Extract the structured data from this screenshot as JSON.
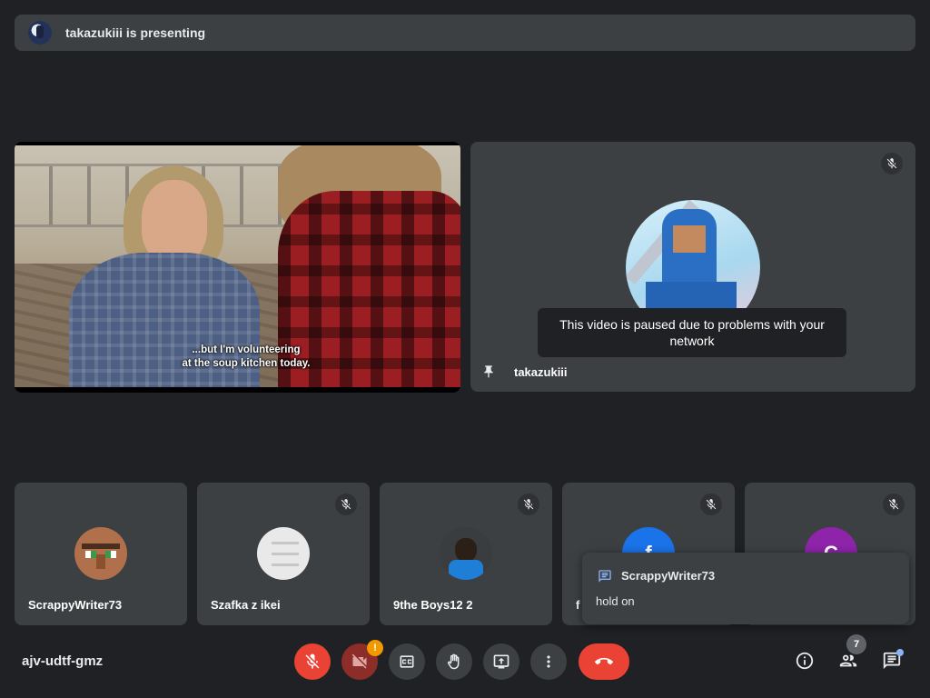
{
  "banner": {
    "presenter_text": "takazukiii is presenting"
  },
  "presentation": {
    "caption": "...but I'm volunteering\nat the soup kitchen today."
  },
  "main_tile": {
    "participant": "takazukiii",
    "paused_message": "This video is paused due to problems with your network"
  },
  "participants": [
    {
      "name": "ScrappyWriter73",
      "avatar": "minecraft-villager",
      "muted": false
    },
    {
      "name": "Szafka z ikei",
      "avatar": "white-dresser",
      "muted": true
    },
    {
      "name": "9the Boys12 2",
      "avatar": "boy-blue-shirt",
      "muted": true
    },
    {
      "name": "f",
      "avatar_letter": "f",
      "avatar_color": "#1a73e8",
      "muted": true
    },
    {
      "name": "",
      "avatar_letter": "C",
      "avatar_color": "#8e24aa",
      "muted": true
    }
  ],
  "toast": {
    "sender": "ScrappyWriter73",
    "message": "hold on"
  },
  "bottom_bar": {
    "meeting_code": "ajv-udtf-gmz",
    "camera_warning_badge": "!",
    "people_count": "7"
  },
  "colors": {
    "background": "#202124",
    "tile": "#3c4043",
    "danger_red": "#ea4335",
    "warning_orange": "#f29900",
    "accent_blue": "#8ab4f8"
  },
  "icons": [
    "mic-off-icon",
    "camera-off-icon",
    "captions-icon",
    "raise-hand-icon",
    "present-screen-icon",
    "more-options-icon",
    "hang-up-icon",
    "info-icon",
    "people-icon",
    "chat-icon",
    "pin-icon",
    "message-icon"
  ]
}
